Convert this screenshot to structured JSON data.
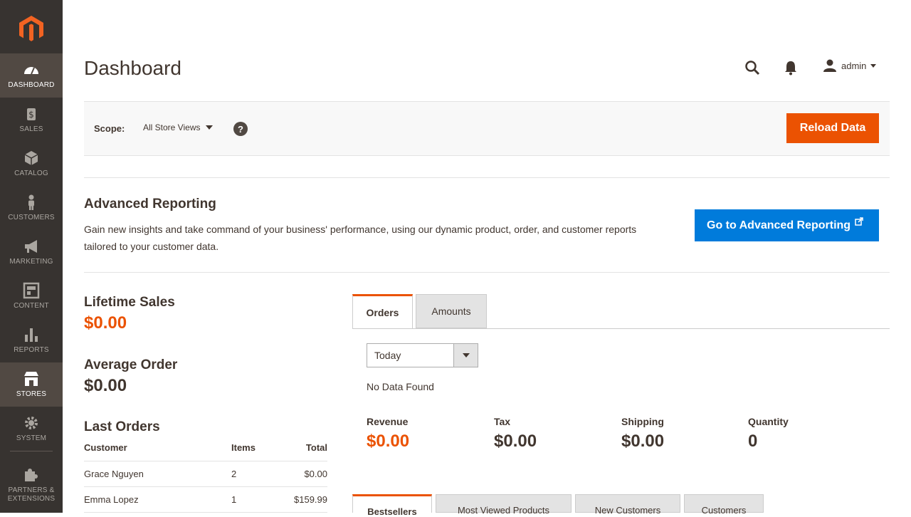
{
  "sidebar": {
    "items": [
      {
        "label": "Dashboard",
        "icon": "dashboard-icon"
      },
      {
        "label": "Sales",
        "icon": "dollar-icon"
      },
      {
        "label": "Catalog",
        "icon": "cube-icon"
      },
      {
        "label": "Customers",
        "icon": "person-icon"
      },
      {
        "label": "Marketing",
        "icon": "megaphone-icon"
      },
      {
        "label": "Content",
        "icon": "layout-icon"
      },
      {
        "label": "Reports",
        "icon": "bar-chart-icon"
      },
      {
        "label": "Stores",
        "icon": "store-icon"
      },
      {
        "label": "System",
        "icon": "gear-icon"
      },
      {
        "label": "Partners & Extensions",
        "icon": "puzzle-icon"
      }
    ]
  },
  "header": {
    "title": "Dashboard",
    "user": "admin"
  },
  "scope": {
    "label": "Scope:",
    "value": "All Store Views",
    "help": "?",
    "reload_label": "Reload Data"
  },
  "advanced": {
    "title": "Advanced Reporting",
    "text": "Gain new insights and take command of your business' performance, using our dynamic product, order, and customer reports tailored to your customer data.",
    "button_label": "Go to Advanced Reporting"
  },
  "stats": {
    "lifetime_label": "Lifetime Sales",
    "lifetime_value": "$0.00",
    "avg_label": "Average Order",
    "avg_value": "$0.00",
    "last_orders_label": "Last Orders"
  },
  "last_orders": {
    "headers": [
      "Customer",
      "Items",
      "Total"
    ],
    "rows": [
      [
        "Grace Nguyen",
        "2",
        "$0.00"
      ],
      [
        "Emma Lopez",
        "1",
        "$159.99"
      ]
    ]
  },
  "chart_tabs": [
    "Orders",
    "Amounts"
  ],
  "period": {
    "value": "Today"
  },
  "no_data": "No Data Found",
  "metrics": [
    {
      "label": "Revenue",
      "value": "$0.00"
    },
    {
      "label": "Tax",
      "value": "$0.00"
    },
    {
      "label": "Shipping",
      "value": "$0.00"
    },
    {
      "label": "Quantity",
      "value": "0"
    }
  ],
  "bottom_tabs": [
    "Bestsellers",
    "Most Viewed Products",
    "New Customers",
    "Customers"
  ],
  "colors": {
    "accent": "#eb5202",
    "blue": "#007bdb",
    "sidebar": "#373330"
  }
}
